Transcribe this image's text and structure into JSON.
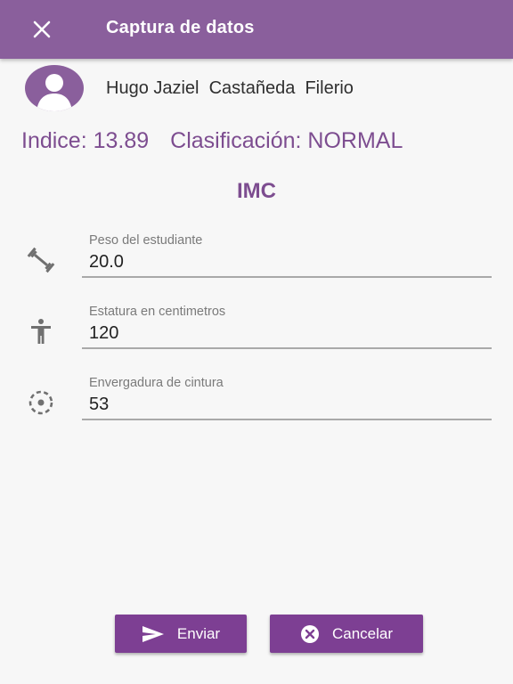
{
  "appbar": {
    "title": "Captura de datos",
    "close_icon": "close-icon",
    "background": "#8a5f9c"
  },
  "student": {
    "name": "Hugo Jaziel  Castañeda  Filerio",
    "avatar_icon": "person-icon"
  },
  "result": {
    "index_label": "Indice: 13.89",
    "classification_label": "Clasificación: NORMAL"
  },
  "section": {
    "title": "IMC"
  },
  "fields": [
    {
      "label": "Peso del estudiante",
      "value": "20.0",
      "icon": "dumbbell-icon"
    },
    {
      "label": "Estatura en centimetros",
      "value": "120",
      "icon": "accessibility-icon"
    },
    {
      "label": "Envergadura de cintura",
      "value": "53",
      "icon": "dashed-circle-icon"
    }
  ],
  "buttons": {
    "send_label": "Enviar",
    "send_icon": "send-icon",
    "cancel_label": "Cancelar",
    "cancel_icon": "cancel-circle-icon"
  },
  "colors": {
    "accent": "#7d4d90",
    "button": "#7d3f93"
  }
}
